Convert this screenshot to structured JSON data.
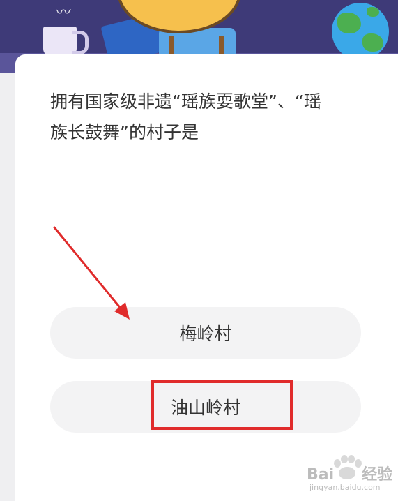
{
  "question": {
    "line1": "拥有国家级非遗“瑶族耍歌堂”、“瑶",
    "line2": "族长鼓舞”的村子是"
  },
  "options": [
    {
      "label": "梅岭村"
    },
    {
      "label": "油山岭村"
    }
  ],
  "annotations": {
    "arrow_target": "option-1",
    "highlight_target": "option-2",
    "color": "#e02b2b"
  },
  "watermark": {
    "brand": "Bai",
    "brand_suffix": "经验",
    "url": "jingyan.baidu.com"
  },
  "colors": {
    "banner": "#3e3a78",
    "card": "#ffffff",
    "option_bg": "#f3f3f4",
    "text": "#333333"
  }
}
